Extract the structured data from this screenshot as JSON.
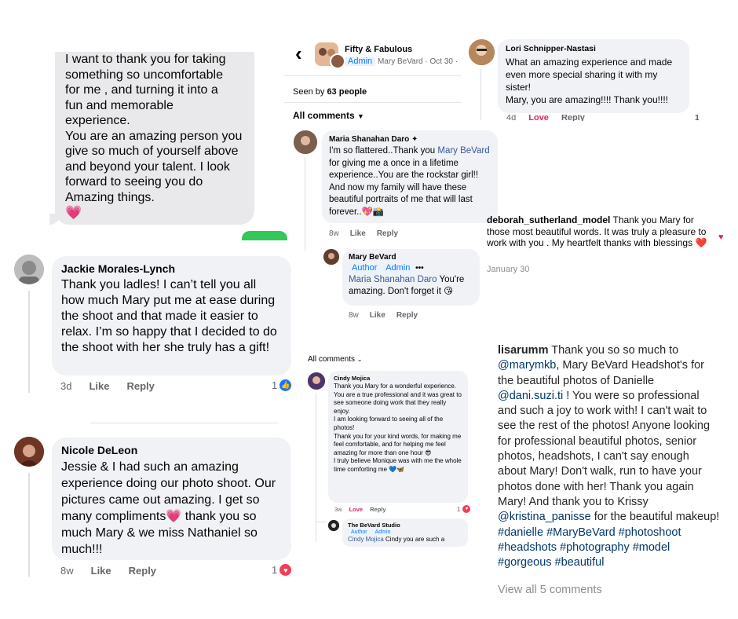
{
  "text_msg": {
    "lines": [
      "I want to thank you for taking",
      "something so uncomfortable",
      "for me , and turning it into a",
      "fun and memorable",
      "experience.",
      "You are an amazing person you",
      "give so much of yourself above",
      "and beyond your  talent. I look",
      "forward to seeing you do",
      "Amazing things."
    ],
    "emoji": "💗"
  },
  "jackie": {
    "name": "Jackie Morales-Lynch",
    "text": "Thank you ladles!  I can’t tell you all how much Mary put me at ease during the shoot and that made it easier to relax.  I’m so happy that I decided to do the shoot with her she truly has a gift!",
    "time": "3d",
    "like": "Like",
    "reply": "Reply",
    "count": "1"
  },
  "nicole": {
    "name": "Nicole DeLeon",
    "text_a": "Jessie & I had such an amazing experience doing our photo shoot. Our pictures came out amazing. I get so many compliments",
    "emoji": "💗",
    "text_b": " thank you so much Mary & we miss Nathaniel so much!!!",
    "time": "8w",
    "like": "Like",
    "reply": "Reply",
    "count": "1"
  },
  "group": {
    "back": "‹",
    "title": "Fifty & Fabulous",
    "admin_tag": "Admin",
    "author": "Mary BeVard",
    "date": "· Oct 30 ·",
    "seen_prefix": "Seen by",
    "seen_count": "63 people",
    "all_comments": "All comments",
    "maria": {
      "name": "Maria Shanahan Daro",
      "text_a": "I'm so flattered..Thank you",
      "mention": "Mary BeVard",
      "text_b": "for giving me a once in a lifetime experience..You are the rockstar girl!! And now my family will have these beautiful portraits of me that will last forever..💖📸",
      "time": "8w",
      "like": "Like",
      "reply": "Reply"
    },
    "mary_reply": {
      "name": "Mary BeVard",
      "tag1": "Author",
      "tag2": "Admin",
      "more": "•••",
      "mention": "Maria Shanahan Daro",
      "text": " You're amazing. Don't forget it 😘",
      "time": "8w",
      "like": "Like",
      "reply": "Reply"
    }
  },
  "lori": {
    "name": "Lori Schnipper-Nastasi",
    "text": "What an amazing experience and made even more special sharing it with my sister!",
    "text2": "Mary, you are amazing!!!! Thank you!!!!",
    "time": "4d",
    "love": "Love",
    "reply": "Reply",
    "count": "1"
  },
  "deborah": {
    "user": "deborah_sutherland_model",
    "text": " Thank you Mary for those most beautiful words. It was truly a pleasure to work with you . My heartfelt thanks with blessings ❤️",
    "date": "January 30"
  },
  "cindy": {
    "all_comments": "All comments",
    "name": "Cindy Mojica",
    "p1": "Thank you Mary for a wonderful experience. You are a true professional and it was great to see someone doing work that they really enjoy.",
    "p2": "I am looking forward to seeing all of the photos!",
    "p3": "Thank you for your kind words, for making me feel comfortable, and for helping me feel amazing for more than one hour 😎",
    "p4": "I truly believe Monique was with me the whole time comforting me 💙🦋",
    "time": "3w",
    "love": "Love",
    "reply": "Reply",
    "count": "1",
    "reply_name": "The BeVard Studio",
    "tag1": "Author",
    "tag2": "Admin",
    "reply_mention": "Cindy Mojica",
    "reply_text": " Cindy you are such a"
  },
  "lisa": {
    "user": "lisarumm",
    "t1": " Thank you so so much to ",
    "m1": "@marymkb",
    "t2": ", Mary BeVard Headshot's for the beautiful photos of Danielle ",
    "m2": "@dani.suzi.ti",
    "t3": " ! You were so professional and such a joy to work with! I can't wait to see the rest of the photos!  Anyone looking for professional beautiful photos, senior photos, headshots, I can't say enough about Mary! Don't walk, run to have your photos done with her! Thank you again Mary! And thank you to Krissy ",
    "m3": "@kristina_panisse",
    "t4": " for the beautiful makeup! ",
    "tags": "#danielle #MaryBeVard #photoshoot #headshots #photography #model #gorgeous #beautiful",
    "view_all": "View all 5 comments"
  },
  "colors": {
    "link": "#385898",
    "love": "#e0245e",
    "like": "#1877f2",
    "bubble": "#f0f2f5"
  }
}
